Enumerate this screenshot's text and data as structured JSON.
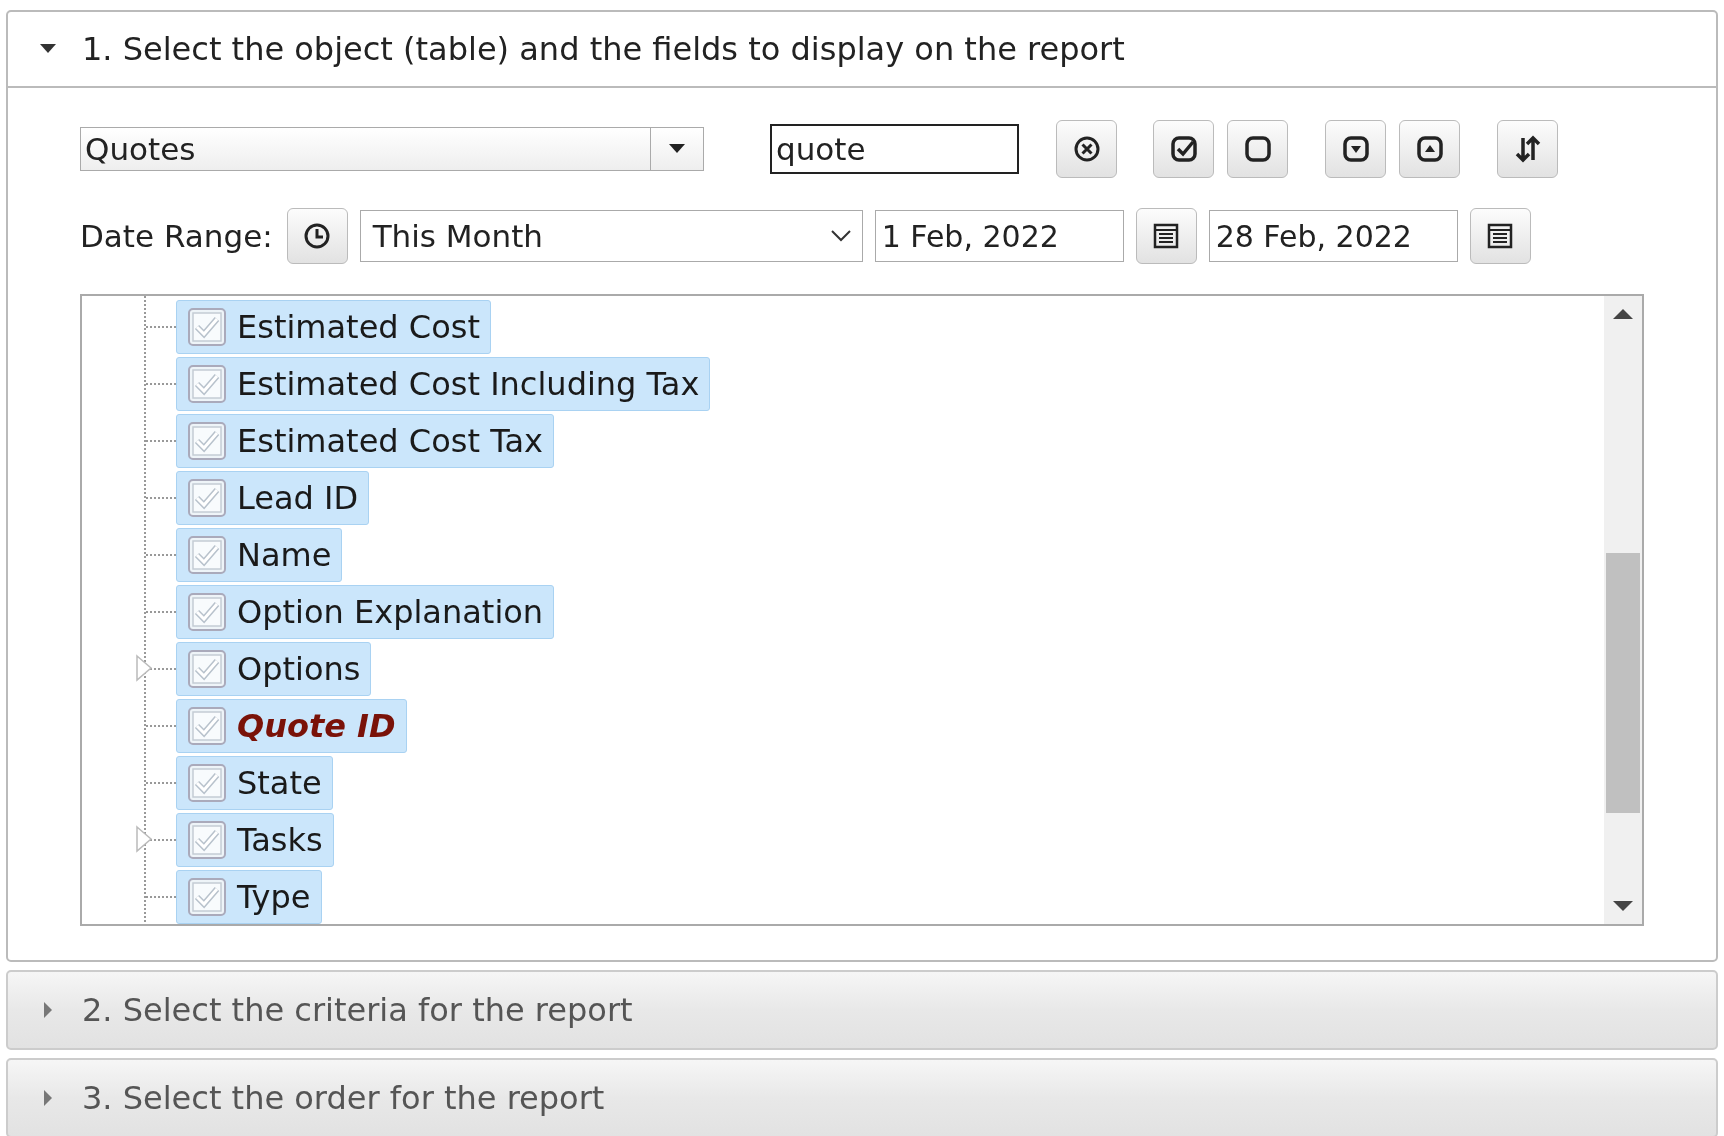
{
  "panels": [
    {
      "title": "1. Select the object (table) and the fields to display on the report",
      "expanded": true
    },
    {
      "title": "2. Select the criteria for the report",
      "expanded": false
    },
    {
      "title": "3. Select the order for the report",
      "expanded": false
    }
  ],
  "object_select": {
    "value": "Quotes"
  },
  "search": {
    "value": "quote"
  },
  "date_range": {
    "label": "Date Range:",
    "preset": "This Month",
    "from": "1 Feb, 2022",
    "to": "28 Feb, 2022"
  },
  "fields": [
    {
      "label": "Estimated Cost",
      "kind": "leaf",
      "checked": true,
      "selected": false
    },
    {
      "label": "Estimated Cost Including Tax",
      "kind": "leaf",
      "checked": true,
      "selected": false
    },
    {
      "label": "Estimated Cost Tax",
      "kind": "leaf",
      "checked": true,
      "selected": false
    },
    {
      "label": "Lead ID",
      "kind": "leaf",
      "checked": true,
      "selected": false
    },
    {
      "label": "Name",
      "kind": "leaf",
      "checked": true,
      "selected": false
    },
    {
      "label": "Option Explanation",
      "kind": "leaf",
      "checked": true,
      "selected": false
    },
    {
      "label": "Options",
      "kind": "branch",
      "expanded": false,
      "checked": true,
      "selected": false
    },
    {
      "label": "Quote ID",
      "kind": "leaf",
      "checked": true,
      "selected": true
    },
    {
      "label": "State",
      "kind": "leaf",
      "checked": true,
      "selected": false
    },
    {
      "label": "Tasks",
      "kind": "branch",
      "expanded": false,
      "checked": true,
      "selected": false
    },
    {
      "label": "Type",
      "kind": "leaf",
      "checked": true,
      "selected": false
    }
  ]
}
